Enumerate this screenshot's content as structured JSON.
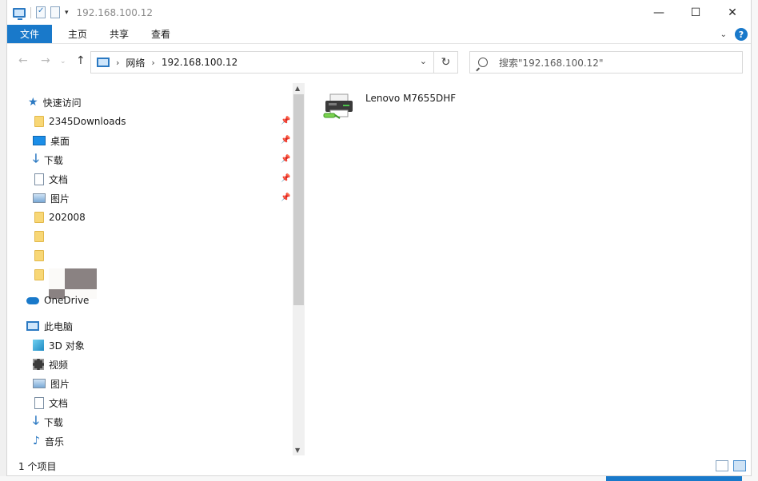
{
  "window": {
    "title": "192.168.100.12",
    "controls": {
      "minimize": "—",
      "maximize": "☐",
      "close": "✕"
    }
  },
  "ribbon": {
    "file_tab": "文件",
    "tabs": [
      "主页",
      "共享",
      "查看"
    ]
  },
  "address": {
    "root": "网络",
    "path": "192.168.100.12"
  },
  "search": {
    "placeholder": "搜索\"192.168.100.12\""
  },
  "nav": {
    "quick_access": "快速访问",
    "items": [
      {
        "label": "2345Downloads",
        "icon": "folder-icon",
        "pinned": true
      },
      {
        "label": "桌面",
        "icon": "desktop-icon",
        "pinned": true
      },
      {
        "label": "下载",
        "icon": "download-icon",
        "pinned": true
      },
      {
        "label": "文档",
        "icon": "documents-icon",
        "pinned": true
      },
      {
        "label": "图片",
        "icon": "pictures-icon",
        "pinned": true
      },
      {
        "label": "202008",
        "icon": "folder-icon",
        "pinned": false
      }
    ],
    "onedrive": "OneDrive",
    "this_pc": "此电脑",
    "pc_items": [
      {
        "label": "3D 对象",
        "icon": "3d-objects-icon"
      },
      {
        "label": "视频",
        "icon": "videos-icon"
      },
      {
        "label": "图片",
        "icon": "pictures-icon"
      },
      {
        "label": "文档",
        "icon": "documents-icon"
      },
      {
        "label": "下载",
        "icon": "download-icon"
      },
      {
        "label": "音乐",
        "icon": "music-icon"
      }
    ]
  },
  "content": {
    "items": [
      {
        "name": "Lenovo M7655DHF",
        "icon": "printer-icon"
      }
    ]
  },
  "status": {
    "item_count": "1 个项目"
  }
}
